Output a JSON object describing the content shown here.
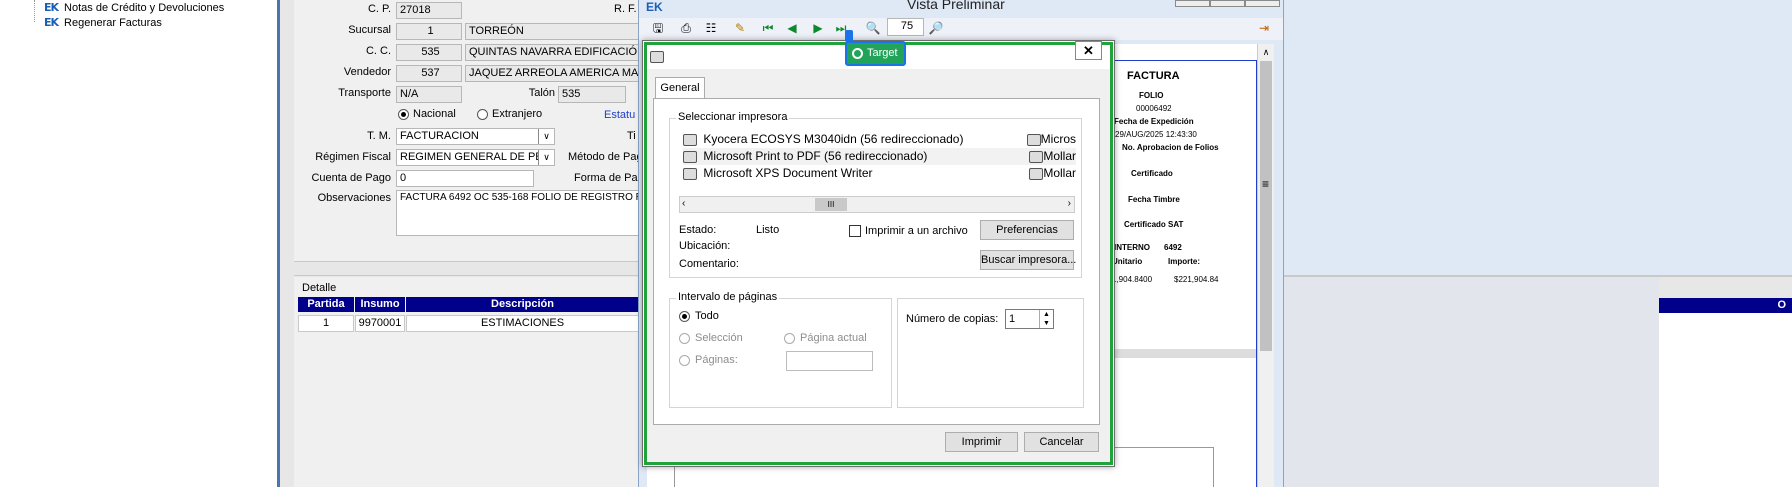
{
  "tree": {
    "items": [
      {
        "label": "Notas de Crédito y Devoluciones"
      },
      {
        "label": "Regenerar Facturas"
      }
    ]
  },
  "form": {
    "cp_label": "C. P.",
    "cp_value": "27018",
    "rf_label": "R. F.",
    "sucursal_label": "Sucursal",
    "sucursal_code": "1",
    "sucursal_name": "TORREÓN",
    "cc_label": "C. C.",
    "cc_code": "535",
    "cc_name": "QUINTAS NAVARRA EDIFICACIÓN",
    "vendedor_label": "Vendedor",
    "vendedor_code": "537",
    "vendedor_name": "JAQUEZ ARREOLA AMERICA MARL",
    "transporte_label": "Transporte",
    "transporte_value": "N/A",
    "talon_label": "Talón",
    "talon_value": "535",
    "nacional_label": "Nacional",
    "extranjero_label": "Extranjero",
    "estatus_label": "Estatu",
    "tm_label": "T. M.",
    "tm_value": "FACTURACION",
    "ti_label": "Ti",
    "regimen_label": "Régimen Fiscal",
    "regimen_value": "REGIMEN GENERAL DE PERS",
    "metodo_label": "Método de Pag",
    "cuenta_label": "Cuenta de Pago",
    "cuenta_value": "0",
    "forma_label": "Forma de Pag",
    "obs_label": "Observaciones",
    "obs_value": "FACTURA 6492  OC 535-168 FOLIO DE REGISTRO REF"
  },
  "detalle": {
    "title": "Detalle",
    "headers": [
      "Partida",
      "Insumo",
      "Descripción"
    ],
    "rows": [
      [
        "1",
        "9970001",
        "ESTIMACIONES"
      ]
    ],
    "right_header": "O"
  },
  "preview": {
    "title": "Vista Preliminar",
    "zoom": "75"
  },
  "invoice": {
    "title": "FACTURA",
    "folio_label": "FOLIO",
    "folio": "00006492",
    "fecha_label": "Fecha de Expedición",
    "fecha": "29/AUG/2025 12:43:30",
    "aprob_label": "No. Aprobacion de Folios",
    "certificado_label": "Certificado",
    "timbre_label": "Fecha Timbre",
    "cert_sat_label": "Certificado SAT",
    "interno_label": "INTERNO",
    "interno_value": "6492",
    "unitario_label": "Unitario",
    "importe_label": "Importe:",
    "unitario_value": "1,904.8400",
    "importe_value": "$221,904.84"
  },
  "target": {
    "label": "Target"
  },
  "print_dialog": {
    "tab": "General",
    "select_printer": "Seleccionar impresora",
    "printers": [
      {
        "name": "Kyocera ECOSYS M3040idn (56 redireccionado)",
        "right": "Micros"
      },
      {
        "name": "Microsoft Print to PDF (56 redireccionado)",
        "right": "Mollar"
      },
      {
        "name": "Microsoft XPS Document Writer",
        "right": "Mollar"
      }
    ],
    "scroll_thumb": "III",
    "estado_label": "Estado:",
    "estado_value": "Listo",
    "ubicacion_label": "Ubicación:",
    "comentario_label": "Comentario:",
    "print_to_file": "Imprimir a un archivo",
    "preferencias": "Preferencias",
    "buscar": "Buscar impresora...",
    "range_group": "Intervalo de páginas",
    "todo": "Todo",
    "seleccion": "Selección",
    "pagina_actual": "Página actual",
    "paginas": "Páginas:",
    "copies_label": "Número de copias:",
    "copies_value": "1",
    "imprimir": "Imprimir",
    "cancelar": "Cancelar",
    "close": "✕"
  }
}
